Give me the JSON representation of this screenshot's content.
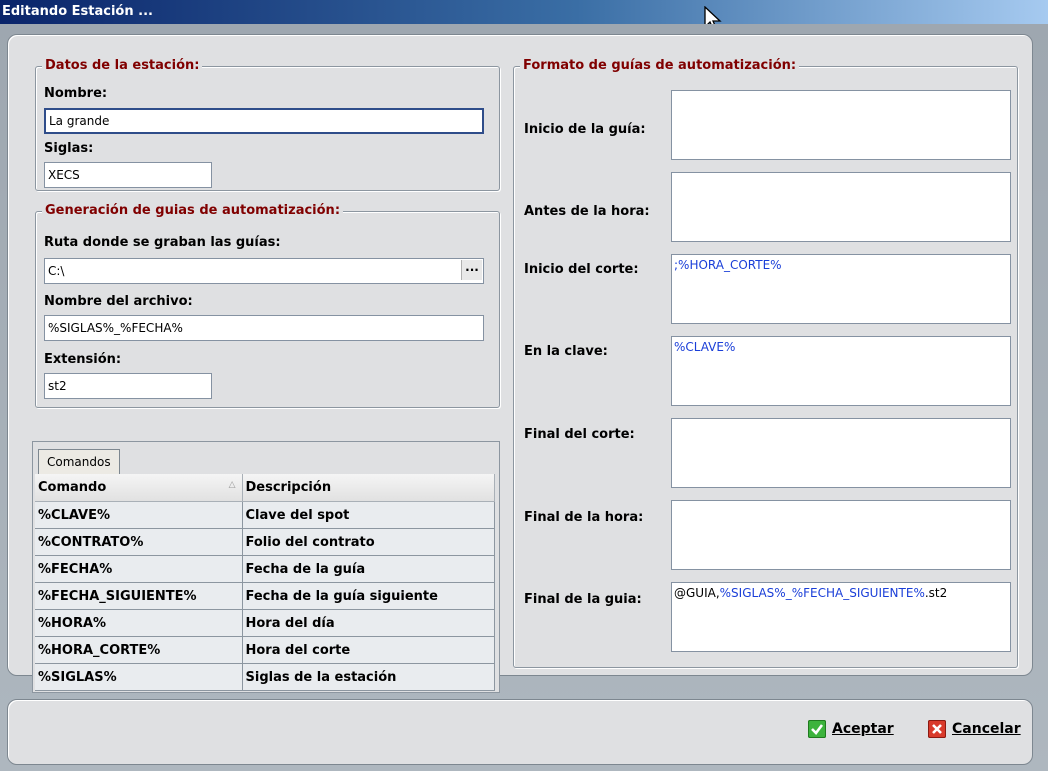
{
  "window": {
    "title": "Editando Estación ..."
  },
  "station": {
    "legend": "Datos de la estación:",
    "name_label": "Nombre:",
    "name_value": "La grande",
    "acronym_label": "Siglas:",
    "acronym_value": "XECS"
  },
  "generation": {
    "legend": "Generación de guias de automatización:",
    "path_label": "Ruta donde se graban las guías:",
    "path_value": "C:\\",
    "browse_label": "...",
    "filename_label": "Nombre del archivo:",
    "filename_value": "%SIGLAS%_%FECHA%",
    "extension_label": "Extensión:",
    "extension_value": "st2"
  },
  "commands": {
    "tab_label": "Comandos",
    "columns": [
      "Comando",
      "Descripción"
    ],
    "rows": [
      [
        "%CLAVE%",
        "Clave del spot"
      ],
      [
        "%CONTRATO%",
        "Folio del contrato"
      ],
      [
        "%FECHA%",
        "Fecha de la guía"
      ],
      [
        "%FECHA_SIGUIENTE%",
        "Fecha de la guía siguiente"
      ],
      [
        "%HORA%",
        "Hora del día"
      ],
      [
        "%HORA_CORTE%",
        "Hora del corte"
      ],
      [
        "%SIGLAS%",
        "Siglas de la estación"
      ]
    ]
  },
  "format": {
    "legend": "Formato de guías de automatización:",
    "fields": [
      {
        "label": "Inicio de la guía:",
        "value": ""
      },
      {
        "label": "Antes de la hora:",
        "value": ""
      },
      {
        "label": "Inicio del corte:",
        "value": ";%HORA_CORTE%"
      },
      {
        "label": "En la clave:",
        "value": "%CLAVE%"
      },
      {
        "label": "Final del corte:",
        "value": ""
      },
      {
        "label": "Final de la hora:",
        "value": ""
      },
      {
        "label": "Final de la guia:",
        "value_prefix": "@GUIA,",
        "value_var": "%SIGLAS%_%FECHA_SIGUIENTE%",
        "value_suffix": ".st2"
      }
    ]
  },
  "actions": {
    "accept": "Aceptar",
    "cancel": "Cancelar"
  },
  "colors": {
    "legend": "#800000",
    "variable_text": "#1a3ed8",
    "accept_icon": "#3cb33c",
    "cancel_icon": "#d93a2b"
  }
}
